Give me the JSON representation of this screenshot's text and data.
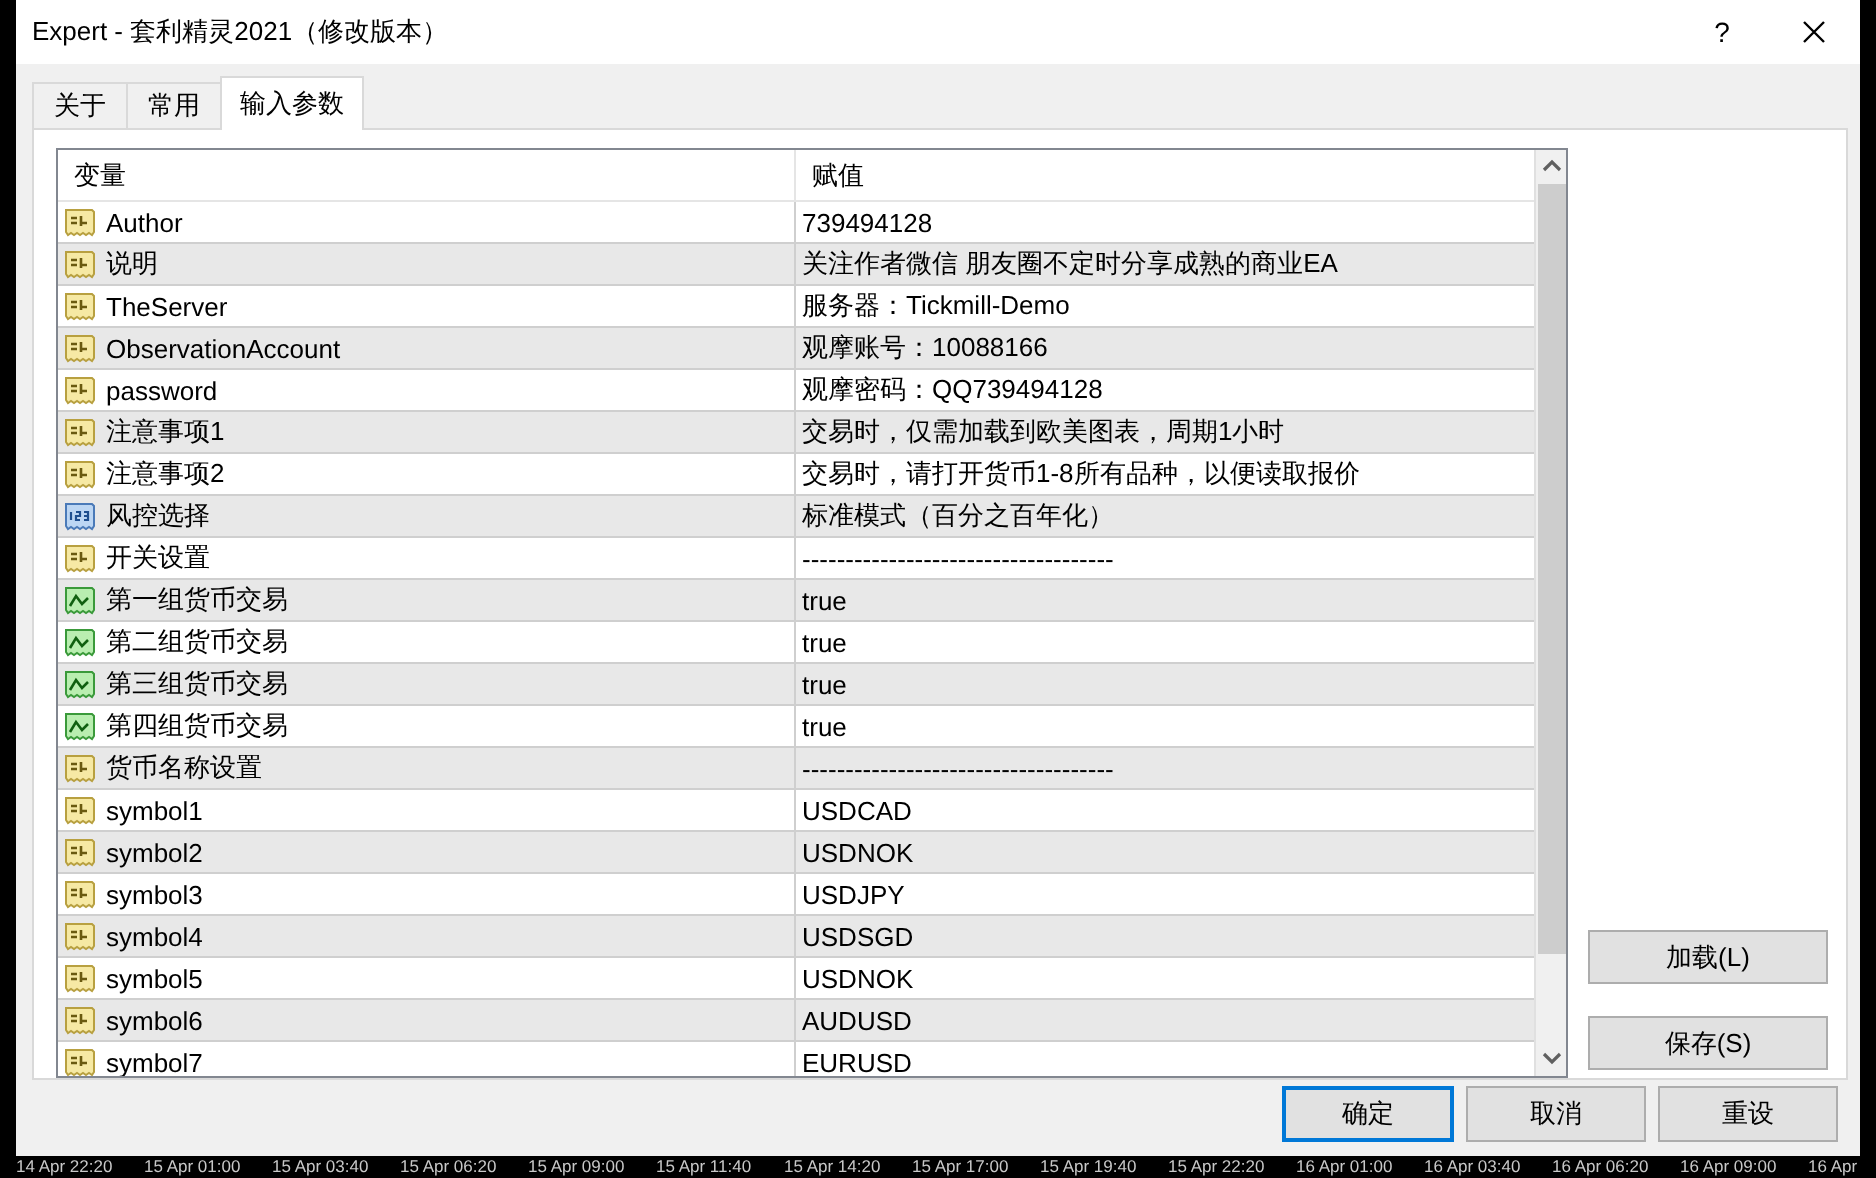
{
  "window": {
    "title": "Expert - 套利精灵2021（修改版本）",
    "help": "?"
  },
  "tabs": [
    {
      "label": "关于",
      "selected": false
    },
    {
      "label": "常用",
      "selected": false
    },
    {
      "label": "输入参数",
      "selected": true
    }
  ],
  "table": {
    "columns": [
      "变量",
      "赋值"
    ],
    "rows": [
      {
        "kind": "text",
        "name": "Author",
        "value": "739494128"
      },
      {
        "kind": "text",
        "name": "说明",
        "value": "关注作者微信 朋友圈不定时分享成熟的商业EA"
      },
      {
        "kind": "text",
        "name": "TheServer",
        "value": "服务器：Tickmill-Demo"
      },
      {
        "kind": "text",
        "name": "ObservationAccount",
        "value": "观摩账号：10088166"
      },
      {
        "kind": "text",
        "name": "password",
        "value": "观摩密码：QQ739494128"
      },
      {
        "kind": "text",
        "name": "注意事项1",
        "value": "交易时，仅需加载到欧美图表，周期1小时"
      },
      {
        "kind": "text",
        "name": "注意事项2",
        "value": "交易时，请打开货币1-8所有品种，以便读取报价"
      },
      {
        "kind": "number",
        "name": "风控选择",
        "value": "标准模式（百分之百年化）"
      },
      {
        "kind": "text",
        "name": "开关设置",
        "value": "------------------------------------"
      },
      {
        "kind": "bool",
        "name": "第一组货币交易",
        "value": "true"
      },
      {
        "kind": "bool",
        "name": "第二组货币交易",
        "value": "true"
      },
      {
        "kind": "bool",
        "name": "第三组货币交易",
        "value": "true"
      },
      {
        "kind": "bool",
        "name": "第四组货币交易",
        "value": "true"
      },
      {
        "kind": "text",
        "name": "货币名称设置",
        "value": "------------------------------------"
      },
      {
        "kind": "text",
        "name": "symbol1",
        "value": "USDCAD"
      },
      {
        "kind": "text",
        "name": "symbol2",
        "value": "USDNOK"
      },
      {
        "kind": "text",
        "name": "symbol3",
        "value": "USDJPY"
      },
      {
        "kind": "text",
        "name": "symbol4",
        "value": "USDSGD"
      },
      {
        "kind": "text",
        "name": "symbol5",
        "value": "USDNOK"
      },
      {
        "kind": "text",
        "name": "symbol6",
        "value": "AUDUSD"
      },
      {
        "kind": "text",
        "name": "symbol7",
        "value": "EURUSD"
      }
    ]
  },
  "side_buttons": [
    "加载(L)",
    "保存(S)"
  ],
  "buttons": [
    {
      "label": "确定",
      "default": true
    },
    {
      "label": "取消",
      "default": false
    },
    {
      "label": "重设",
      "default": false
    }
  ],
  "time_axis": [
    "14 Apr 22:20",
    "15 Apr 01:00",
    "15 Apr 03:40",
    "15 Apr 06:20",
    "15 Apr 09:00",
    "15 Apr 11:40",
    "15 Apr 14:20",
    "15 Apr 17:00",
    "15 Apr 19:40",
    "15 Apr 22:20",
    "16 Apr 01:00",
    "16 Apr 03:40",
    "16 Apr 06:20",
    "16 Apr 09:00",
    "16 Apr"
  ]
}
